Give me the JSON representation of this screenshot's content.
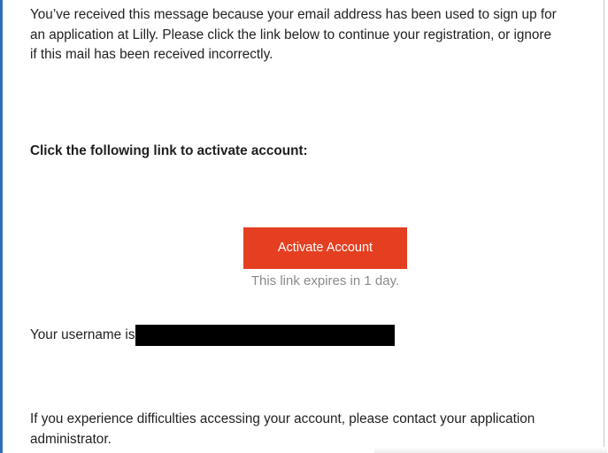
{
  "email": {
    "intro_line1": "You’ve received this message because your email address has been used to sign up for",
    "intro_line2": "an application at Lilly. Please click the link below to continue your registration, or ignore",
    "intro_line3": "if this mail has been received incorrectly.",
    "cta_heading": "Click the following link to activate account:",
    "activate_button_label": "Activate Account",
    "expiry_text": "This link expires in 1 day.",
    "username_prefix": "Your username is",
    "support_line1": "If you experience difficulties accessing your account, please contact your application",
    "support_line2": "administrator."
  },
  "colors": {
    "button": "#e53f22",
    "frame_accent": "#2f6fb7",
    "expiry_text": "#8a8a8a"
  }
}
